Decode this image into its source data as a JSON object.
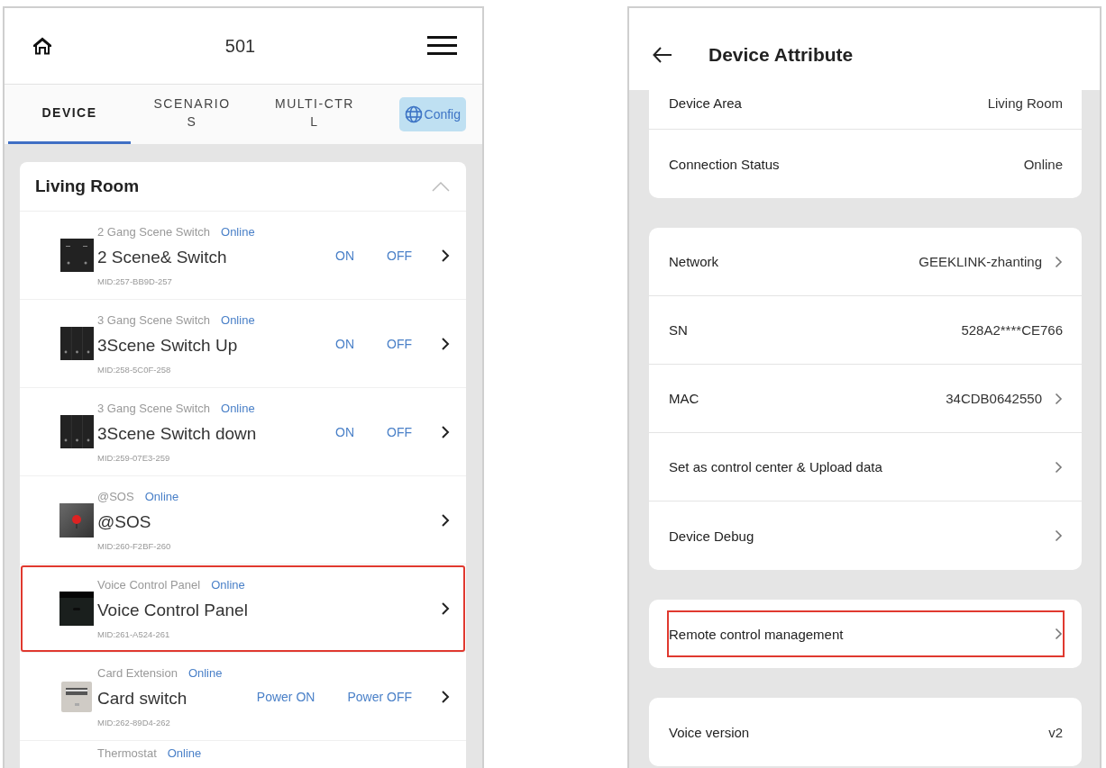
{
  "left_screen": {
    "header": {
      "title": "501"
    },
    "tabs": [
      {
        "label": "DEVICE",
        "selected": true
      },
      {
        "label": "SCENARIOS",
        "selected": false
      },
      {
        "label": "MULTI-CTRL",
        "selected": false
      }
    ],
    "config_button": {
      "label": "Config"
    },
    "room": {
      "title": "Living Room",
      "expanded": true
    },
    "devices": [
      {
        "kind": "two_gang",
        "type": "2 Gang Scene Switch",
        "status": "Online",
        "name": "2 Scene& Switch",
        "mid": "MID:257-BB9D-257",
        "actions": [
          "ON",
          "OFF"
        ],
        "highlighted": false
      },
      {
        "kind": "three_gang",
        "type": "3 Gang Scene Switch",
        "status": "Online",
        "name": "3Scene Switch Up",
        "mid": "MID:258-5C0F-258",
        "actions": [
          "ON",
          "OFF"
        ],
        "highlighted": false
      },
      {
        "kind": "three_gang",
        "type": "3 Gang Scene Switch",
        "status": "Online",
        "name": "3Scene Switch down",
        "mid": "MID:259-07E3-259",
        "actions": [
          "ON",
          "OFF"
        ],
        "highlighted": false
      },
      {
        "kind": "sos",
        "type": "@SOS",
        "status": "Online",
        "name": "@SOS",
        "mid": "MID:260-F2BF-260",
        "highlighted": false
      },
      {
        "kind": "voice_panel",
        "type": "Voice Control Panel",
        "status": "Online",
        "name": "Voice Control Panel",
        "mid": "MID:261-A524-261",
        "highlighted": true
      },
      {
        "kind": "card",
        "type": "Card Extension",
        "status": "Online",
        "name": "Card switch",
        "mid": "MID:262-89D4-262",
        "actions": [
          "Power ON",
          "Power OFF"
        ],
        "highlighted": false
      },
      {
        "kind": "partial",
        "type": "Thermostat",
        "status": "Online",
        "highlighted": false
      }
    ]
  },
  "right_screen": {
    "header": {
      "title": "Device Attribute"
    },
    "groups": [
      {
        "rows": [
          {
            "label": "Device Area",
            "value": "Living Room",
            "chevron": false,
            "highlighted": false,
            "cut": true
          },
          {
            "label": "Connection Status",
            "value": "Online",
            "chevron": false,
            "highlighted": false
          }
        ]
      },
      {
        "rows": [
          {
            "label": "Network",
            "value": "GEEKLINK-zhanting",
            "chevron": true,
            "highlighted": false
          },
          {
            "label": "SN",
            "value": "528A2****CE766",
            "chevron": false,
            "highlighted": false
          },
          {
            "label": "MAC",
            "value": "34CDB0642550",
            "chevron": true,
            "highlighted": false
          },
          {
            "label": "Set as control center & Upload data",
            "chevron": true,
            "highlighted": false
          },
          {
            "label": "Device Debug",
            "chevron": true,
            "highlighted": false
          }
        ]
      },
      {
        "rows": [
          {
            "label": "Remote control management",
            "chevron": true,
            "highlighted": true
          }
        ]
      },
      {
        "rows": [
          {
            "label": "Voice version",
            "value": "v2",
            "chevron": false,
            "highlighted": false
          }
        ]
      }
    ]
  }
}
